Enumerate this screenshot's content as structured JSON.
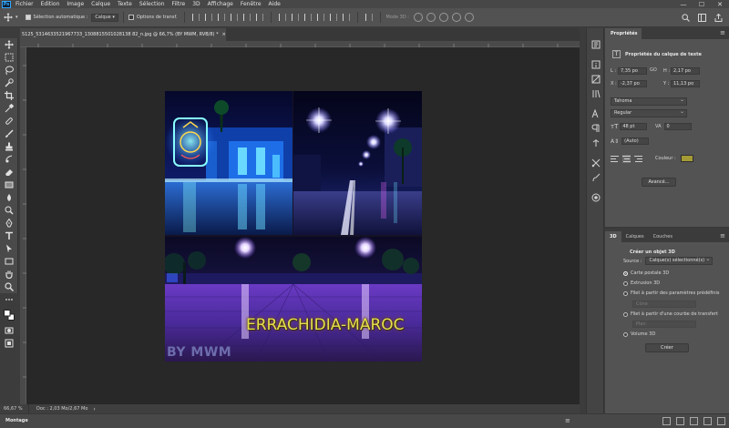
{
  "menubar": {
    "logo": "Ps",
    "items": [
      "Fichier",
      "Edition",
      "Image",
      "Calque",
      "Texte",
      "Sélection",
      "Filtre",
      "3D",
      "Affichage",
      "Fenêtre",
      "Aide"
    ],
    "window_controls": {
      "minimize": "—",
      "maximize": "☐",
      "close": "✕"
    }
  },
  "optionsbar": {
    "auto_select_label": "Sélection automatique :",
    "auto_select_value": "Calque",
    "transform_label": "Options de transf.",
    "mode3d_label": "Mode 3D :"
  },
  "document": {
    "tab_title": "5125_5314633521967733_1308815501028138 82_n.jpg @ 66,7% (BY MWM, RVB/8) *",
    "close": "×",
    "artwork_title": "ERRACHIDIA-MAROC",
    "artwork_credit": "BY MWM"
  },
  "statusbar": {
    "zoom": "66,67 %",
    "doc_info": "Doc : 2,03 Mo/2,67 Mo",
    "arrow": "›"
  },
  "timeline": {
    "label": "Montage",
    "menu": "≡"
  },
  "properties": {
    "tab": "Propriétés",
    "menu": "≡",
    "header": "Propriétés du calque de texte",
    "l_label": "L :",
    "l_value": "7,35 po",
    "go_label": "GO",
    "h_label": "H :",
    "h_value": "2,17 po",
    "x_label": "X :",
    "x_value": "-2,37 po",
    "y_label": "Y :",
    "y_value": "11,13 po",
    "font_family": "Tahoma",
    "font_style": "Regular",
    "font_size": "48 pt",
    "tracking": "0",
    "leading": "(Auto)",
    "color_label": "Couleur :",
    "color_hex": "#a59b36",
    "advanced_button": "Avancé..."
  },
  "threed": {
    "tabs": [
      "3D",
      "Calques",
      "Couches"
    ],
    "menu": "≡",
    "title": "Créer un objet 3D",
    "source_label": "Source :",
    "source_value": "Calque(s) sélectionné(s)",
    "options": [
      {
        "label": "Carte postale 3D",
        "selected": true
      },
      {
        "label": "Extrusion 3D",
        "selected": false
      },
      {
        "label": "Filet à partir des paramètres prédéfinis",
        "selected": false
      },
      {
        "label": "Filet à partir d'une courbe de transfert",
        "selected": false
      },
      {
        "label": "Volume 3D",
        "selected": false
      }
    ],
    "preset_placeholder": "Cône",
    "curve_placeholder": "Plan",
    "create_button": "Créer"
  },
  "colors": {
    "app_bg": "#3c3c3c",
    "workspace_bg": "#282828",
    "panel_bg": "#535353",
    "title_yellow": "#e6e04b"
  },
  "icons": {
    "toolbar": [
      "move-tool",
      "marquee-tool",
      "lasso-tool",
      "quick-select-tool",
      "crop-tool",
      "eyedropper-tool",
      "healing-brush-tool",
      "brush-tool",
      "clone-stamp-tool",
      "history-brush-tool",
      "eraser-tool",
      "gradient-tool",
      "blur-tool",
      "dodge-tool",
      "pen-tool",
      "type-tool",
      "path-select-tool",
      "rectangle-tool",
      "hand-tool",
      "zoom-tool",
      "more-tools",
      "foreground-background-colors",
      "quick-mask",
      "screen-mode"
    ]
  }
}
